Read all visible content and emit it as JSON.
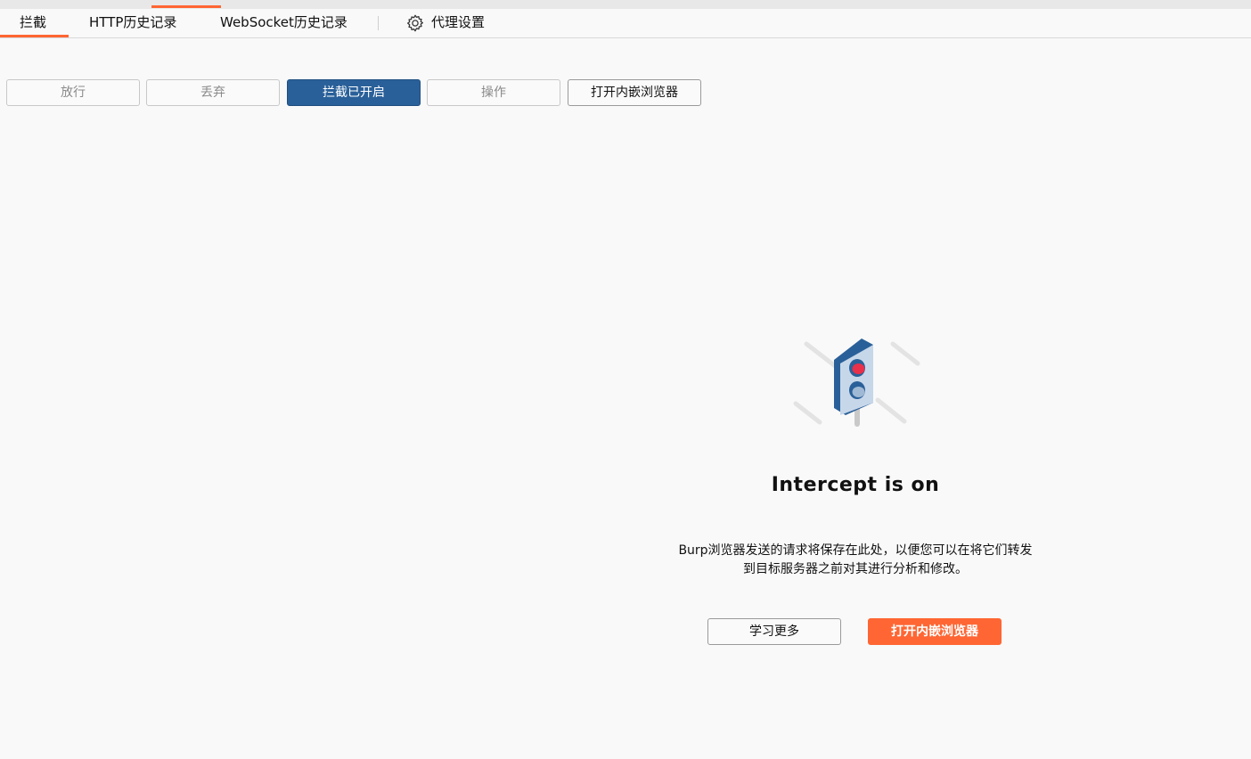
{
  "colors": {
    "accent": "#ff6633",
    "primary": "#2a6099",
    "background": "#f9f9f9"
  },
  "subtabs": [
    {
      "label": "拦截",
      "active": true
    },
    {
      "label": "HTTP历史记录",
      "active": false
    },
    {
      "label": "WebSocket历史记录",
      "active": false
    },
    {
      "label": "代理设置",
      "icon": "gear-icon",
      "active": false
    }
  ],
  "toolbar": {
    "forward": "放行",
    "drop": "丢弃",
    "intercept_toggle": "拦截已开启",
    "action": "操作",
    "open_browser": "打开内嵌浏览器"
  },
  "empty_state": {
    "icon": "traffic-light-icon",
    "title": "Intercept is on",
    "description_line1": "Burp浏览器发送的请求将保存在此处，以便您可以在将它们转发",
    "description_line2": "到目标服务器之前对其进行分析和修改。",
    "learn_more": "学习更多",
    "open_browser": "打开内嵌浏览器"
  }
}
